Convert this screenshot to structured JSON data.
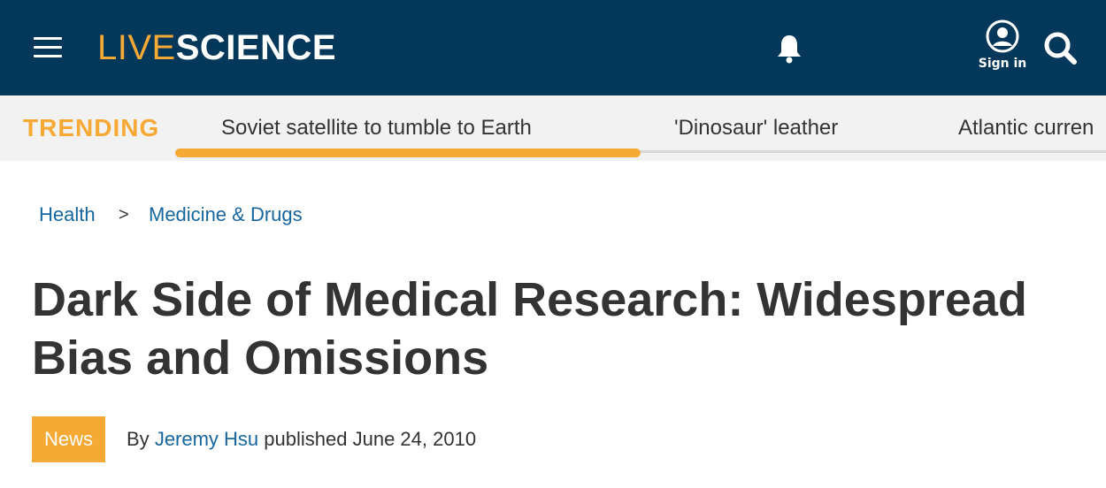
{
  "header": {
    "logo_live": "LIVE",
    "logo_science": "SCIENCE",
    "signin_label": "Sign in",
    "brand_color": "#04385a",
    "accent_color": "#f7a935"
  },
  "trending": {
    "label": "TRENDING",
    "items": [
      {
        "label": "Soviet satellite to tumble to Earth",
        "active": true
      },
      {
        "label": "'Dinosaur' leather",
        "active": false
      },
      {
        "label": "Atlantic curren",
        "active": false
      }
    ]
  },
  "breadcrumb": {
    "items": [
      "Health",
      "Medicine & Drugs"
    ],
    "separator": ">"
  },
  "article": {
    "title": "Dark Side of Medical Research: Widespread Bias and Omissions",
    "category_badge": "News",
    "by_prefix": "By",
    "author": "Jeremy Hsu",
    "published_text": "published June 24, 2010",
    "link_color": "#16669f"
  }
}
